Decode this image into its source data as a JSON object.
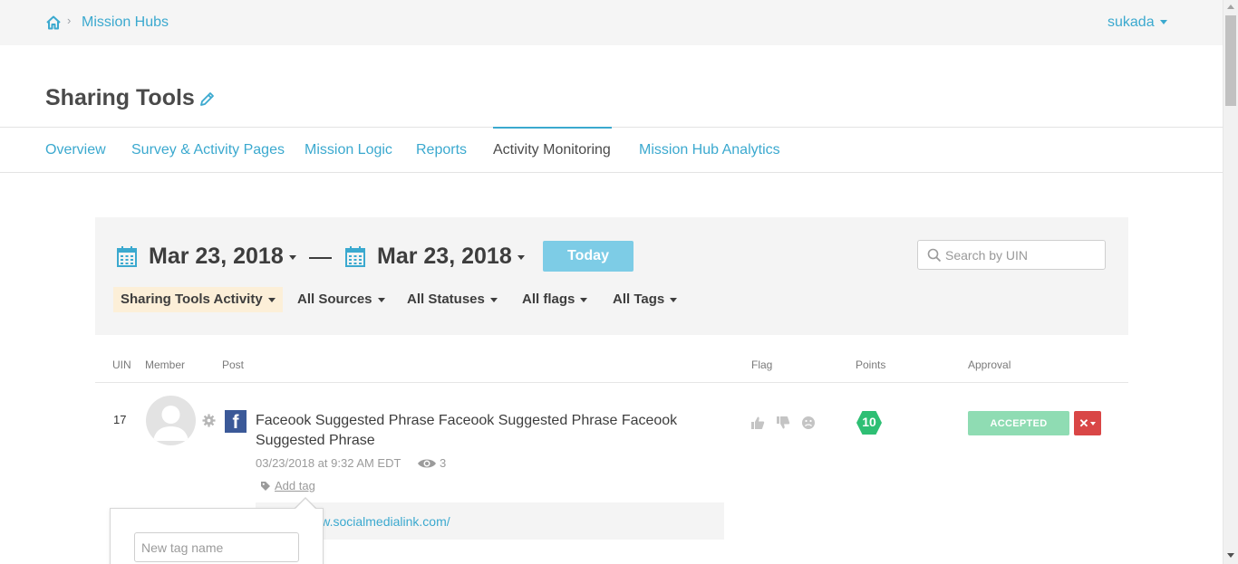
{
  "breadcrumb": {
    "home_icon": "home-icon",
    "separator": "›",
    "link": "Mission Hubs"
  },
  "user": {
    "name": "sukada"
  },
  "page": {
    "title": "Sharing Tools",
    "edit_icon": "pencil-icon"
  },
  "tabs": [
    {
      "label": "Overview",
      "active": false
    },
    {
      "label": "Survey & Activity Pages",
      "active": false
    },
    {
      "label": "Mission Logic",
      "active": false
    },
    {
      "label": "Reports",
      "active": false
    },
    {
      "label": "Activity Monitoring",
      "active": true
    },
    {
      "label": "Mission Hub Analytics",
      "active": false
    }
  ],
  "filters": {
    "start_date": "Mar 23, 2018",
    "end_date": "Mar 23, 2018",
    "today_label": "Today",
    "search_placeholder": "Search by UIN",
    "dropdowns": [
      {
        "label": "Sharing Tools Activity",
        "highlighted": true
      },
      {
        "label": "All Sources",
        "highlighted": false
      },
      {
        "label": "All Statuses",
        "highlighted": false
      },
      {
        "label": "All flags",
        "highlighted": false
      },
      {
        "label": "All Tags",
        "highlighted": false
      }
    ]
  },
  "table": {
    "headers": {
      "uin": "UIN",
      "member": "Member",
      "post": "Post",
      "flag": "Flag",
      "points": "Points",
      "approval": "Approval"
    },
    "rows": [
      {
        "uin": "17",
        "source_icon": "facebook-icon",
        "source_letter": "f",
        "post_text": "Faceook Suggested Phrase Faceook Suggested Phrase Faceook Suggested Phrase",
        "timestamp": "03/23/2018 at 9:32 AM EDT",
        "views": "3",
        "add_tag_label": "Add tag",
        "link": "https://www.socialmedialink.com/",
        "points": "10",
        "status": "ACCEPTED",
        "reject_symbol": "✕"
      }
    ]
  },
  "tag_popover": {
    "placeholder": "New tag name"
  },
  "colors": {
    "link": "#3ba9cf",
    "today_button": "#7dcce6",
    "accepted": "#8fdcb3",
    "reject": "#d94646",
    "points_badge": "#2ebf74",
    "facebook": "#3b5998",
    "filter_highlight": "#fcefd8"
  }
}
